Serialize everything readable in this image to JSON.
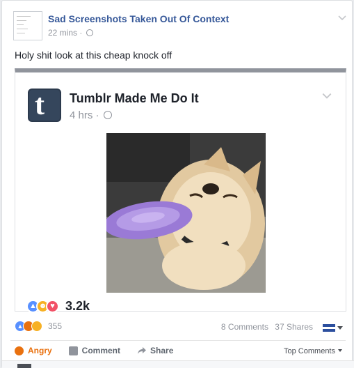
{
  "post": {
    "page_name": "Sad Screenshots Taken Out Of Context",
    "time": "22 mins ·",
    "caption": "Holy shit look at this cheap knock off"
  },
  "shared": {
    "page_name": "Tumblr Made Me Do It",
    "time": "4 hrs ·",
    "avatar_letter": "t",
    "reaction_count": "3.2k",
    "reactions": [
      "like",
      "haha",
      "love"
    ]
  },
  "footer": {
    "reaction_count": "355",
    "reactions": [
      "like",
      "angry",
      "sad"
    ],
    "comments": "8 Comments",
    "shares": "37 Shares",
    "actions": {
      "angry": "Angry",
      "comment": "Comment",
      "share": "Share"
    },
    "sort": "Top Comments"
  },
  "colors": {
    "link": "#365899",
    "meta": "#90949c",
    "angry": "#e9710f",
    "like": "#5890ff",
    "love": "#f25268",
    "haha": "#f7b125",
    "tumblr": "#35465c"
  }
}
